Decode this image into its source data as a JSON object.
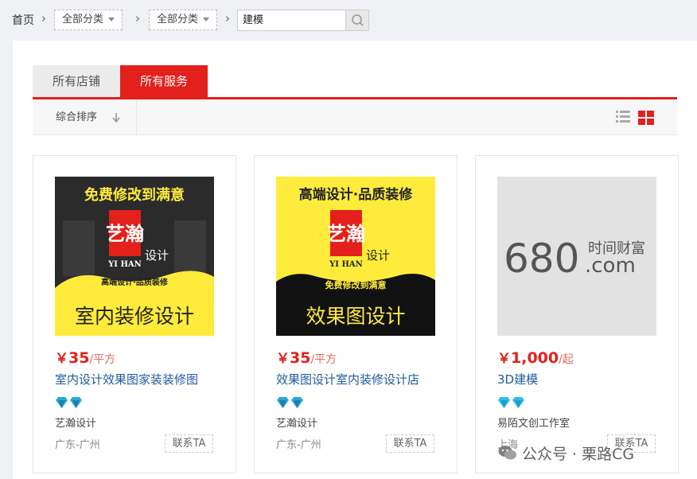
{
  "breadcrumb": {
    "home": "首页",
    "separator": "›",
    "category1": "全部分类",
    "category2": "全部分类",
    "search_value": "建模"
  },
  "tabs": [
    {
      "label": "所有店铺",
      "active": false
    },
    {
      "label": "所有服务",
      "active": true
    }
  ],
  "sort": {
    "label": "综合排序"
  },
  "colors": {
    "accent": "#e3201b",
    "link": "#1f5b9e",
    "gem": "#29a9d8",
    "banner_yellow": "#ffeb3b"
  },
  "products": [
    {
      "image": {
        "top_text": "免费修改到满意",
        "logo_cn": "艺瀚",
        "logo_side": "设计",
        "logo_en": "YI HAN",
        "mid_text": "高端设计·品质装修",
        "bottom_text": "室内装修设计"
      },
      "price_symbol": "￥",
      "price": "35",
      "unit": "/平方",
      "title": "室内设计效果图家装装修图",
      "shop": "艺瀚设计",
      "location": "广东-广州",
      "contact": "联系TA"
    },
    {
      "image": {
        "top_text": "高端设计·品质装修",
        "logo_cn": "艺瀚",
        "logo_side": "设计",
        "logo_en": "YI HAN",
        "mid_text": "免费修改到满意",
        "bottom_text": "效果图设计"
      },
      "price_symbol": "￥",
      "price": "35",
      "unit": "/平方",
      "title": "效果图设计室内装修设计店",
      "shop": "艺瀚设计",
      "location": "广东-广州",
      "contact": "联系TA"
    },
    {
      "image": {
        "big_text": "680",
        "small_top": "时间财富",
        "small_bottom": ".com"
      },
      "price_symbol": "￥",
      "price": "1,000",
      "unit": "/起",
      "title": "3D建模",
      "shop": "易陌文创工作室",
      "location": "上海",
      "contact": "联系TA"
    }
  ],
  "watermark": "公众号 · 栗路CG"
}
